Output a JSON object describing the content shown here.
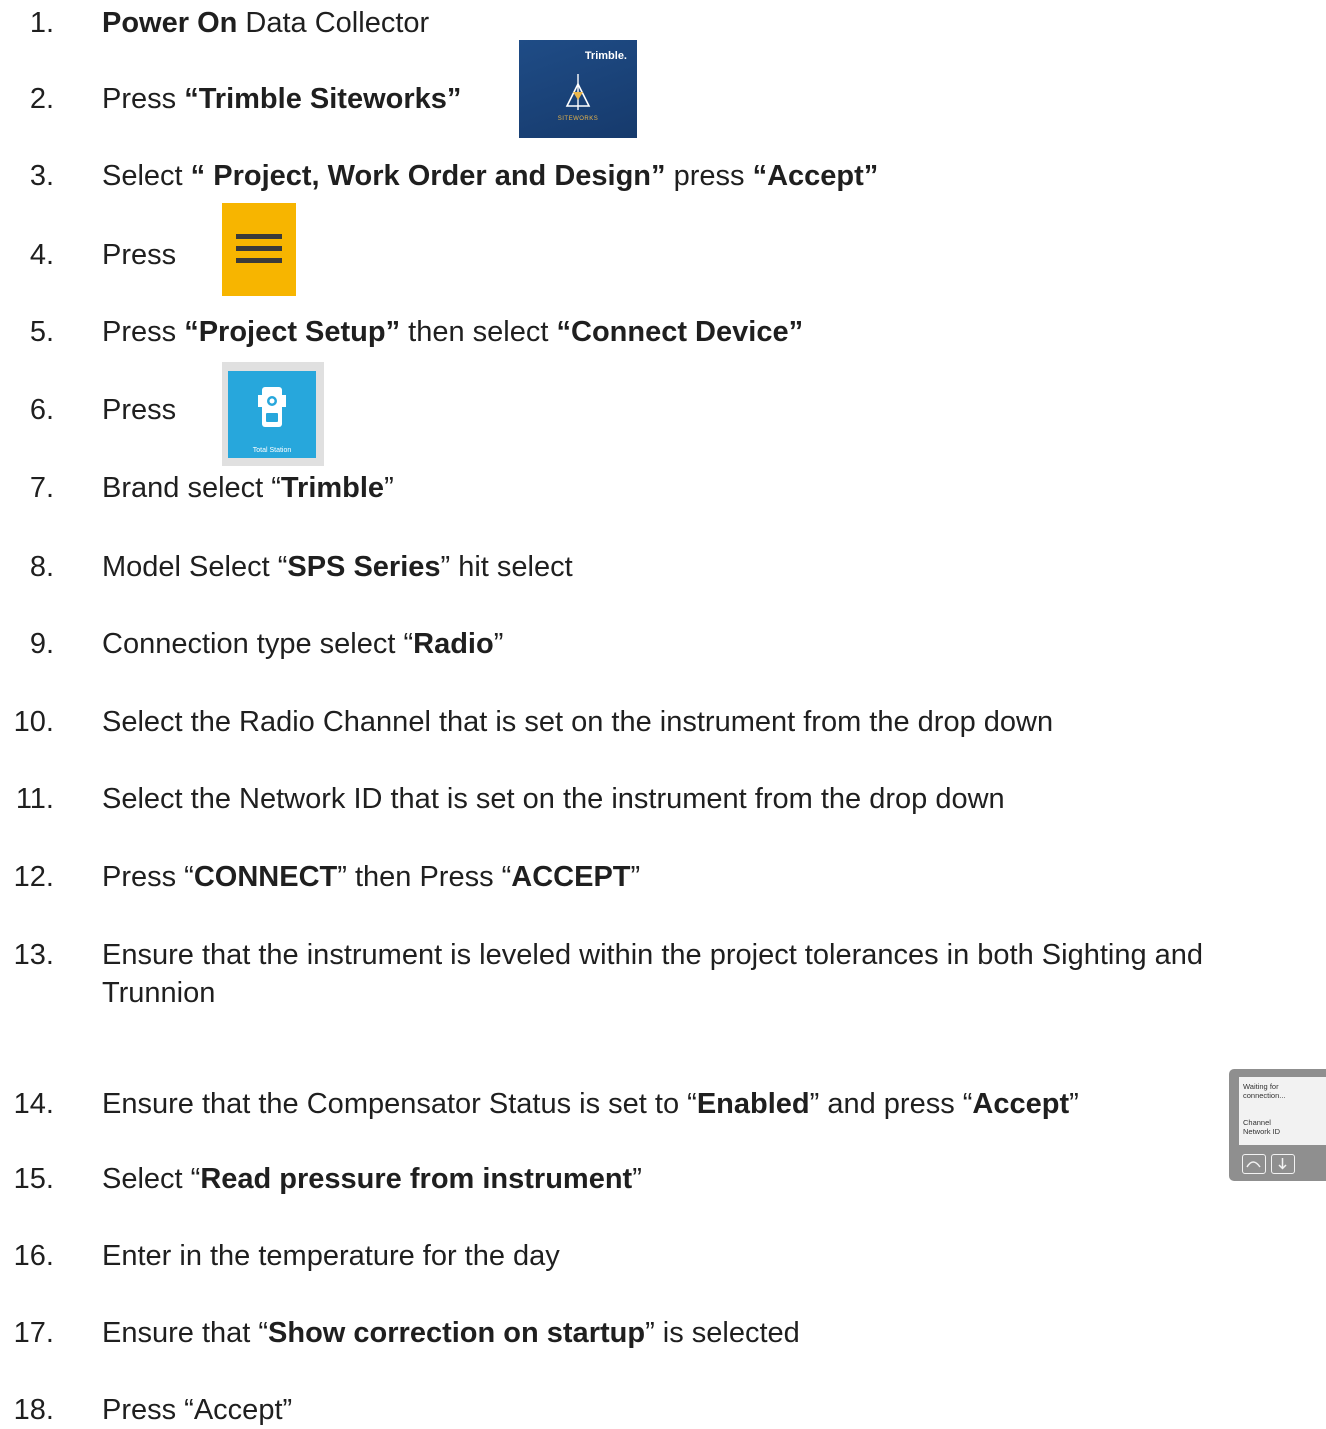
{
  "steps": [
    {
      "num": "1.",
      "parts": [
        {
          "b": "Power On"
        },
        {
          "t": " Data Collector"
        }
      ]
    },
    {
      "num": "2.",
      "parts": [
        {
          "t": "Press "
        },
        {
          "b": "“Trimble Siteworks”"
        }
      ]
    },
    {
      "num": "3.",
      "parts": [
        {
          "t": "Select "
        },
        {
          "b": "“ Project, Work Order and Design”"
        },
        {
          "t": " press "
        },
        {
          "b": "“Accept”"
        }
      ]
    },
    {
      "num": "4.",
      "parts": [
        {
          "t": "Press"
        }
      ]
    },
    {
      "num": "5.",
      "parts": [
        {
          "t": " Press "
        },
        {
          "b": "“Project Setup”"
        },
        {
          "t": " then select "
        },
        {
          "b": "“Connect Device”"
        }
      ]
    },
    {
      "num": "6.",
      "parts": [
        {
          "t": "Press"
        }
      ]
    },
    {
      "num": "7.",
      "parts": [
        {
          "t": "Brand select “"
        },
        {
          "b": "Trimble"
        },
        {
          "t": "”"
        }
      ]
    },
    {
      "num": "8.",
      "parts": [
        {
          "t": "Model Select “"
        },
        {
          "b": "SPS Series"
        },
        {
          "t": "” hit select"
        }
      ]
    },
    {
      "num": "9.",
      "parts": [
        {
          "t": "Connection type select “"
        },
        {
          "b": "Radio"
        },
        {
          "t": "”"
        }
      ]
    },
    {
      "num": "10.",
      "parts": [
        {
          "t": "Select the Radio Channel that is set on the instrument from the drop down"
        }
      ]
    },
    {
      "num": "11.",
      "parts": [
        {
          "t": "Select the Network ID that is set on the instrument from the drop down"
        }
      ]
    },
    {
      "num": "12.",
      "parts": [
        {
          "t": "Press “"
        },
        {
          "b": "CONNECT"
        },
        {
          "t": "” then Press “"
        },
        {
          "b": "ACCEPT"
        },
        {
          "t": "”"
        }
      ]
    },
    {
      "num": "13.",
      "parts": [
        {
          "t": "Ensure that the instrument is leveled within the project tolerances in both Sighting and"
        }
      ],
      "line2": "Trunnion"
    },
    {
      "num": "14.",
      "parts": [
        {
          "t": "Ensure that the Compensator Status is set to “"
        },
        {
          "b": "Enabled"
        },
        {
          "t": "” and press “"
        },
        {
          "b": "Accept"
        },
        {
          "t": "”"
        }
      ]
    },
    {
      "num": "15.",
      "parts": [
        {
          "t": "Select “"
        },
        {
          "b": "Read pressure from instrument"
        },
        {
          "t": "”"
        }
      ]
    },
    {
      "num": "16.",
      "parts": [
        {
          "t": "Enter in the temperature for the day"
        }
      ]
    },
    {
      "num": "17.",
      "parts": [
        {
          "t": "Ensure that “"
        },
        {
          "b": "Show correction on startup"
        },
        {
          "t": "” is selected"
        }
      ]
    },
    {
      "num": "18.",
      "parts": [
        {
          "t": "Press “Accept”"
        }
      ]
    }
  ],
  "siteworks_icon": {
    "brand": "Trimble.",
    "subtitle": "SITEWORKS",
    "colors": {
      "bg": "#1f4c86",
      "accent": "#e8b54b"
    }
  },
  "menu_icon": {
    "icon": "hamburger-menu-icon",
    "colors": {
      "bg": "#f7b500",
      "bars": "#3a3a3a"
    }
  },
  "total_station_icon": {
    "caption": "Total Station",
    "colors": {
      "bg": "#27a7dc"
    }
  },
  "instrument_display": {
    "line1": "Waiting for",
    "line2": "connection...",
    "line3": "Channel",
    "line4": "Network ID"
  }
}
